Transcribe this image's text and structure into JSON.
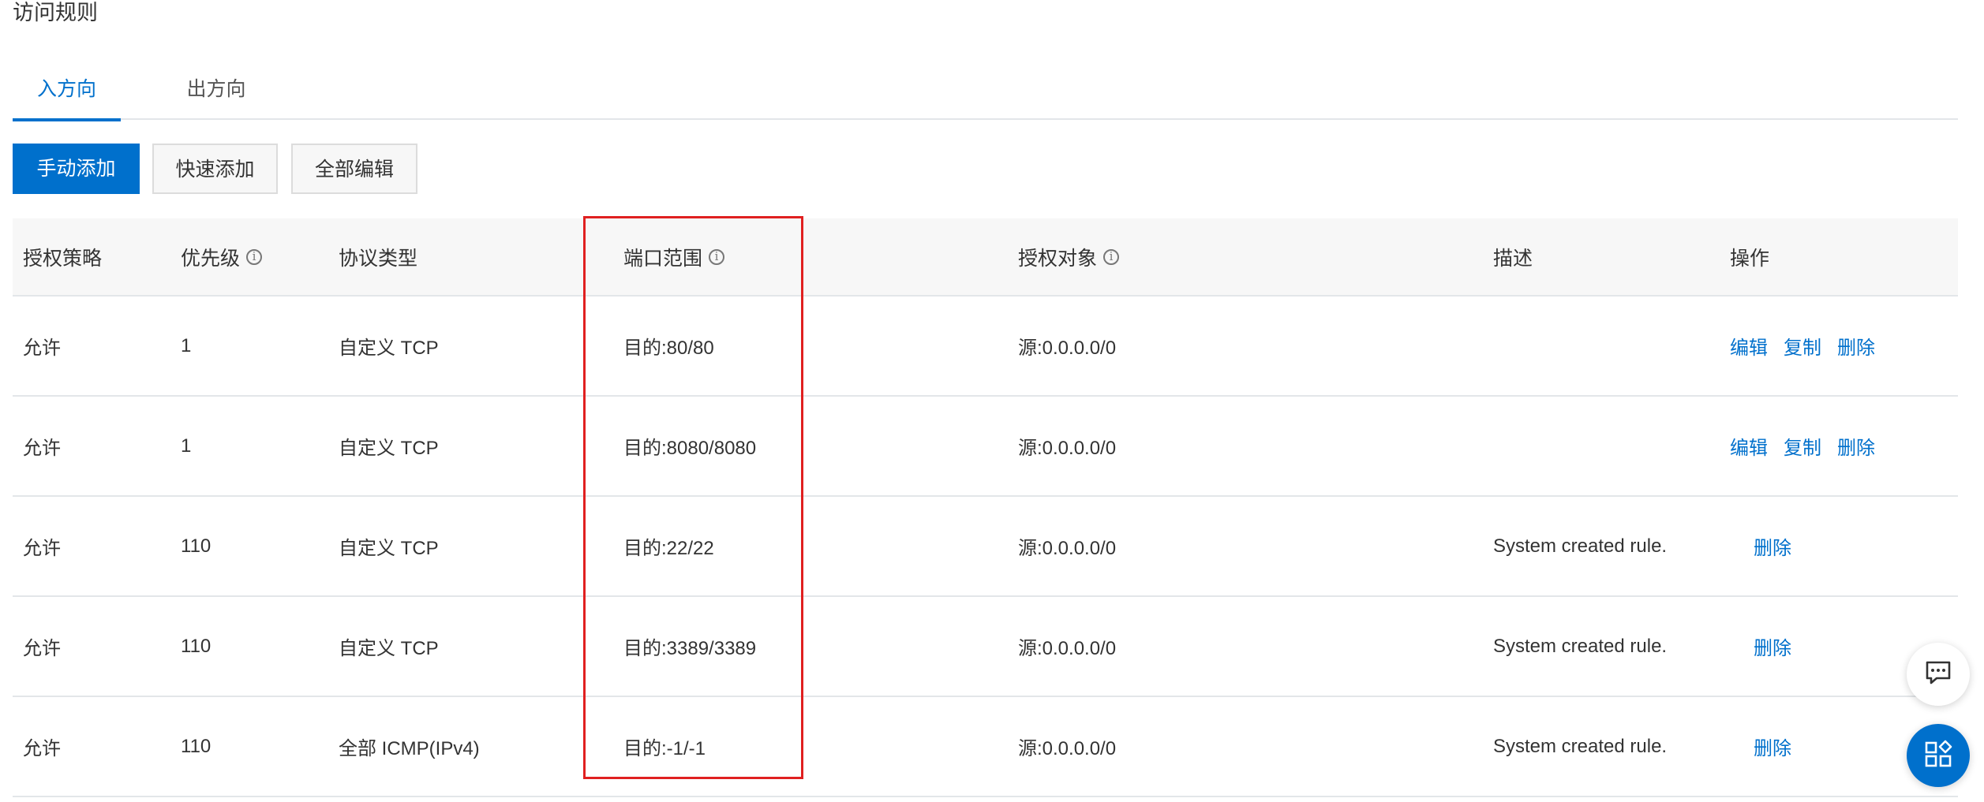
{
  "page": {
    "title": "访问规则"
  },
  "tabs": [
    {
      "label": "入方向",
      "active": true
    },
    {
      "label": "出方向",
      "active": false
    }
  ],
  "toolbar": {
    "manual_add": "手动添加",
    "quick_add": "快速添加",
    "edit_all": "全部编辑"
  },
  "table": {
    "headers": {
      "policy": "授权策略",
      "priority": "优先级",
      "protocol": "协议类型",
      "port_range": "端口范围",
      "auth_object": "授权对象",
      "description": "描述",
      "actions": "操作"
    },
    "rows": [
      {
        "policy": "允许",
        "priority": "1",
        "protocol": "自定义 TCP",
        "port": "目的:80/80",
        "object": "源:0.0.0.0/0",
        "description": "",
        "actions": [
          "编辑",
          "复制",
          "删除"
        ]
      },
      {
        "policy": "允许",
        "priority": "1",
        "protocol": "自定义 TCP",
        "port": "目的:8080/8080",
        "object": "源:0.0.0.0/0",
        "description": "",
        "actions": [
          "编辑",
          "复制",
          "删除"
        ]
      },
      {
        "policy": "允许",
        "priority": "110",
        "protocol": "自定义 TCP",
        "port": "目的:22/22",
        "object": "源:0.0.0.0/0",
        "description": "System created rule.",
        "actions": [
          "删除"
        ]
      },
      {
        "policy": "允许",
        "priority": "110",
        "protocol": "自定义 TCP",
        "port": "目的:3389/3389",
        "object": "源:0.0.0.0/0",
        "description": "System created rule.",
        "actions": [
          "删除"
        ]
      },
      {
        "policy": "允许",
        "priority": "110",
        "protocol": "全部 ICMP(IPv4)",
        "port": "目的:-1/-1",
        "object": "源:0.0.0.0/0",
        "description": "System created rule.",
        "actions": [
          "删除"
        ]
      }
    ]
  },
  "icons": {
    "info": "info-icon",
    "chat": "chat-icon",
    "apps": "apps-icon"
  },
  "colors": {
    "accent": "#0070cc",
    "highlight": "#e02020"
  }
}
